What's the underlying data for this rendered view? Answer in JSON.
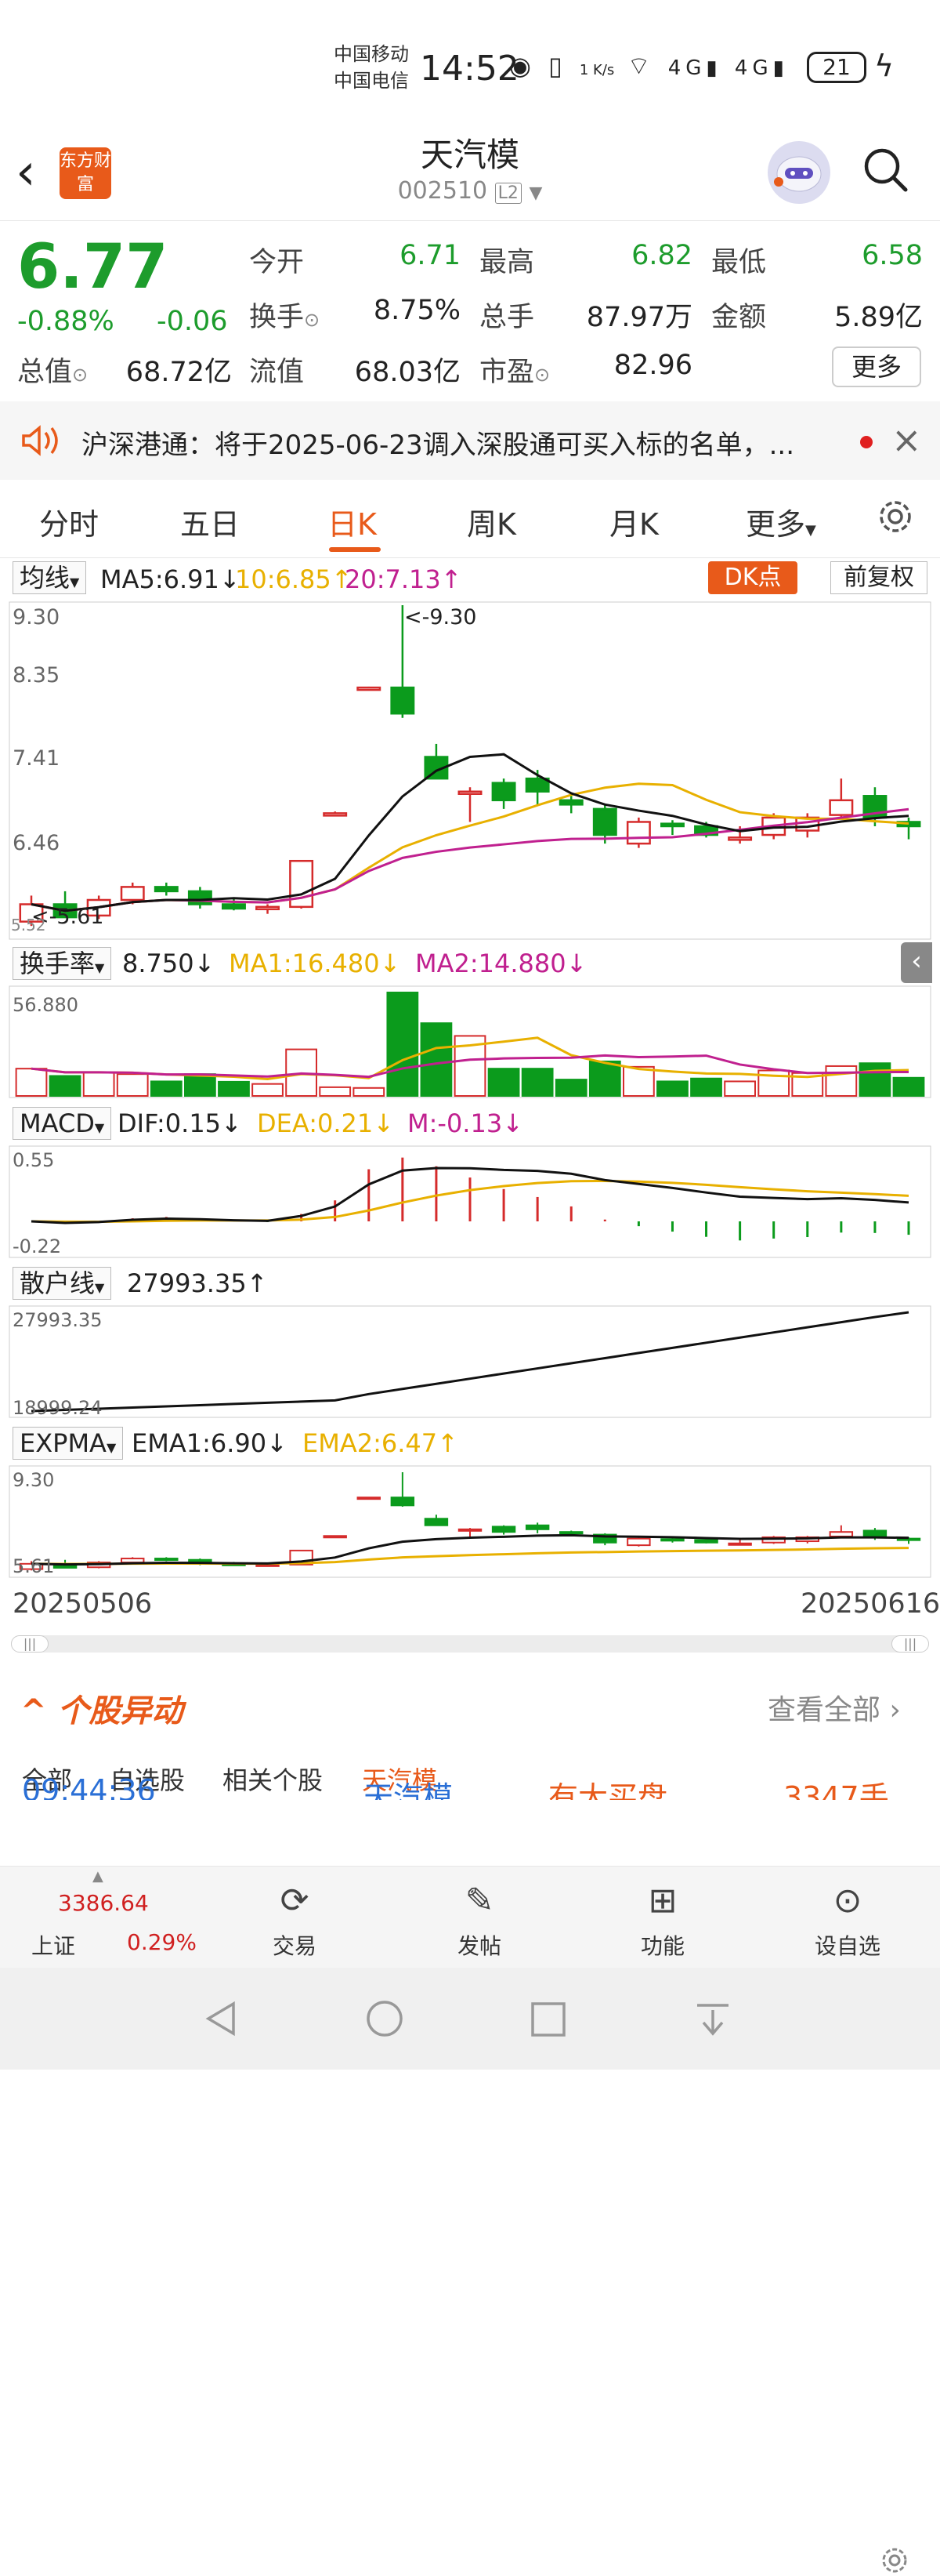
{
  "status_bar": {
    "carrier1": "中国移动",
    "carrier2": "中国电信",
    "time": "14:52",
    "net_speed": "1 K/s",
    "battery": "21"
  },
  "header": {
    "logo_text": "东方财富",
    "title": "天汽模",
    "code": "002510",
    "level": "L2"
  },
  "quote": {
    "price": "6.77",
    "change_pct": "-0.88%",
    "change": "-0.06",
    "fields": [
      {
        "label": "今开",
        "value": "6.71",
        "color": "green"
      },
      {
        "label": "最高",
        "value": "6.82",
        "color": "green"
      },
      {
        "label": "最低",
        "value": "6.58",
        "color": "green"
      },
      {
        "label": "换手",
        "value": "8.75%",
        "color": "black"
      },
      {
        "label": "总手",
        "value": "87.97万",
        "color": "black"
      },
      {
        "label": "金额",
        "value": "5.89亿",
        "color": "black"
      },
      {
        "label": "总值",
        "value": "68.72亿",
        "color": "black"
      },
      {
        "label": "流值",
        "value": "68.03亿",
        "color": "black"
      },
      {
        "label": "市盈",
        "value": "82.96",
        "color": "black"
      }
    ],
    "more": "更多"
  },
  "notice": {
    "text": "沪深港通：将于2025-06-23调入深股通可买入标的名单，..."
  },
  "tabs": [
    "分时",
    "五日",
    "日K",
    "周K",
    "月K",
    "更多"
  ],
  "active_tab": "日K",
  "main_chart": {
    "selector": "均线",
    "ma5": "MA5:6.91↓",
    "ma10": "10:6.85↑",
    "ma20": "20:7.13↑",
    "dk": "DK点",
    "adjust": "前复权",
    "y_labels": [
      "9.30",
      "8.35",
      "7.41",
      "6.46"
    ],
    "high_mark": "<-9.30",
    "low_mark": "<-5.61",
    "bottom_label": "5.52"
  },
  "volume": {
    "selector": "换手率",
    "value": "8.750↓",
    "ma1": "MA1:16.480↓",
    "ma2": "MA2:14.880↓",
    "max_label": "56.880"
  },
  "macd": {
    "selector": "MACD",
    "dif": "DIF:0.15↓",
    "dea": "DEA:0.21↓",
    "m": "M:-0.13↓",
    "top": "0.55",
    "bottom": "-0.22"
  },
  "retail": {
    "selector": "散户线",
    "value": "27993.35↑",
    "top": "27993.35",
    "bottom": "18999.24"
  },
  "expma": {
    "selector": "EXPMA",
    "ema1": "EMA1:6.90↓",
    "ema2": "EMA2:6.47↑",
    "top": "9.30",
    "bottom": "5.61"
  },
  "dates": {
    "start": "20250506",
    "end": "20250616"
  },
  "chart_data": {
    "type": "candlestick",
    "title": "",
    "ylim": [
      5.52,
      9.3
    ],
    "candles": [
      [
        5.65,
        5.95,
        5.6,
        5.85
      ],
      [
        5.85,
        6.0,
        5.8,
        5.7
      ],
      [
        5.72,
        5.95,
        5.68,
        5.9
      ],
      [
        5.9,
        6.1,
        5.85,
        6.05
      ],
      [
        6.05,
        6.1,
        5.95,
        6.0
      ],
      [
        6.0,
        6.05,
        5.8,
        5.85
      ],
      [
        5.85,
        5.92,
        5.78,
        5.8
      ],
      [
        5.8,
        5.85,
        5.74,
        5.82
      ],
      [
        5.82,
        6.35,
        5.8,
        6.35
      ],
      [
        6.9,
        6.92,
        6.88,
        6.9
      ],
      [
        8.35,
        8.36,
        8.34,
        8.35
      ],
      [
        8.35,
        9.3,
        8.0,
        8.05
      ],
      [
        7.55,
        7.7,
        7.3,
        7.3
      ],
      [
        7.15,
        7.2,
        6.8,
        7.15
      ],
      [
        7.25,
        7.3,
        6.95,
        7.05
      ],
      [
        7.3,
        7.4,
        7.0,
        7.15
      ],
      [
        7.05,
        7.1,
        6.9,
        7.0
      ],
      [
        6.95,
        7.0,
        6.55,
        6.65
      ],
      [
        6.55,
        6.85,
        6.5,
        6.8
      ],
      [
        6.78,
        6.82,
        6.65,
        6.75
      ],
      [
        6.75,
        6.8,
        6.62,
        6.65
      ],
      [
        6.62,
        6.75,
        6.55,
        6.62
      ],
      [
        6.65,
        6.9,
        6.6,
        6.85
      ],
      [
        6.7,
        6.9,
        6.62,
        6.85
      ],
      [
        6.88,
        7.3,
        6.85,
        7.05
      ],
      [
        7.1,
        7.2,
        6.75,
        6.85
      ],
      [
        6.8,
        6.85,
        6.6,
        6.75
      ]
    ]
  }
}
